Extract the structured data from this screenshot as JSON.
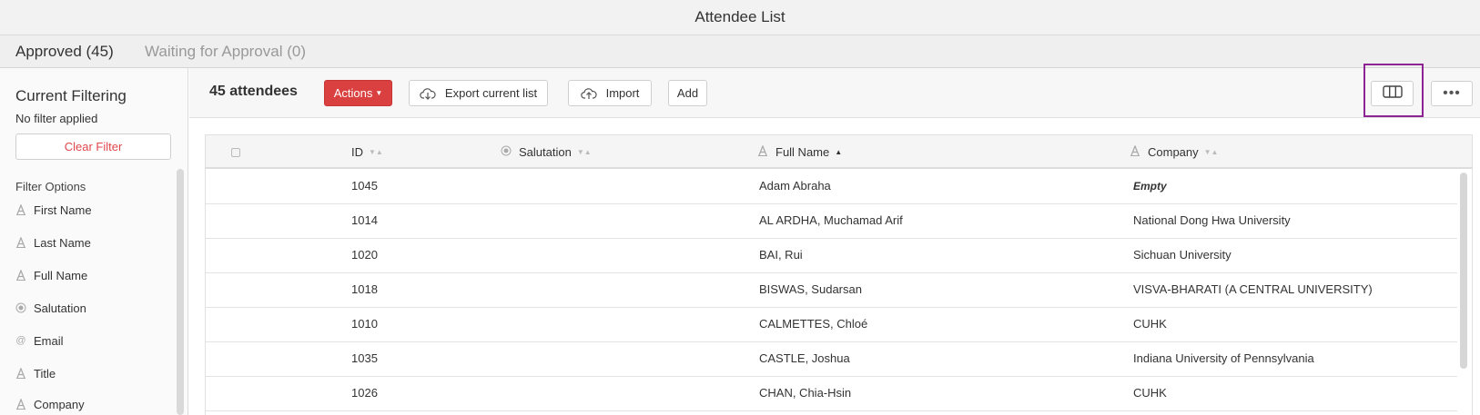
{
  "window": {
    "title": "Attendee List"
  },
  "tabs": [
    {
      "label": "Approved (45)",
      "active": true
    },
    {
      "label": "Waiting for Approval (0)",
      "active": false
    }
  ],
  "sidebar": {
    "title": "Current Filtering",
    "status": "No filter applied",
    "clear_label": "Clear Filter",
    "options_label": "Filter Options",
    "filters": [
      {
        "label": "First Name",
        "icon": "text-icon"
      },
      {
        "label": "Last Name",
        "icon": "text-icon"
      },
      {
        "label": "Full Name",
        "icon": "text-icon"
      },
      {
        "label": "Salutation",
        "icon": "radio-icon"
      },
      {
        "label": "Email",
        "icon": "at-icon"
      },
      {
        "label": "Title",
        "icon": "text-icon"
      },
      {
        "label": "Company",
        "icon": "text-icon"
      }
    ]
  },
  "toolbar": {
    "count": "45 attendees",
    "actions_label": "Actions",
    "export_label": "Export current list",
    "import_label": "Import",
    "add_label": "Add",
    "highlight_color": "#8e2493"
  },
  "table": {
    "columns": [
      {
        "label": "ID",
        "icon": "",
        "sort": "none"
      },
      {
        "label": "Salutation",
        "icon": "radio-icon",
        "sort": "none"
      },
      {
        "label": "Full Name",
        "icon": "text-icon",
        "sort": "asc"
      },
      {
        "label": "Company",
        "icon": "text-icon",
        "sort": "none"
      }
    ],
    "rows": [
      {
        "id": "1045",
        "full_name": "Adam Abraha",
        "company": "Empty",
        "company_empty": true
      },
      {
        "id": "1014",
        "full_name": "AL ARDHA, Muchamad Arif",
        "company": "National Dong Hwa University"
      },
      {
        "id": "1020",
        "full_name": "BAI, Rui",
        "company": "Sichuan University"
      },
      {
        "id": "1018",
        "full_name": "BISWAS, Sudarsan",
        "company": "VISVA-BHARATI (A CENTRAL UNIVERSITY)"
      },
      {
        "id": "1010",
        "full_name": "CALMETTES, Chloé",
        "company": "CUHK"
      },
      {
        "id": "1035",
        "full_name": "CASTLE, Joshua",
        "company": "Indiana University of Pennsylvania"
      },
      {
        "id": "1026",
        "full_name": "CHAN, Chia-Hsin",
        "company": "CUHK"
      }
    ]
  },
  "colors": {
    "accent_red": "#d9403f",
    "clear_text": "#e0474c"
  }
}
